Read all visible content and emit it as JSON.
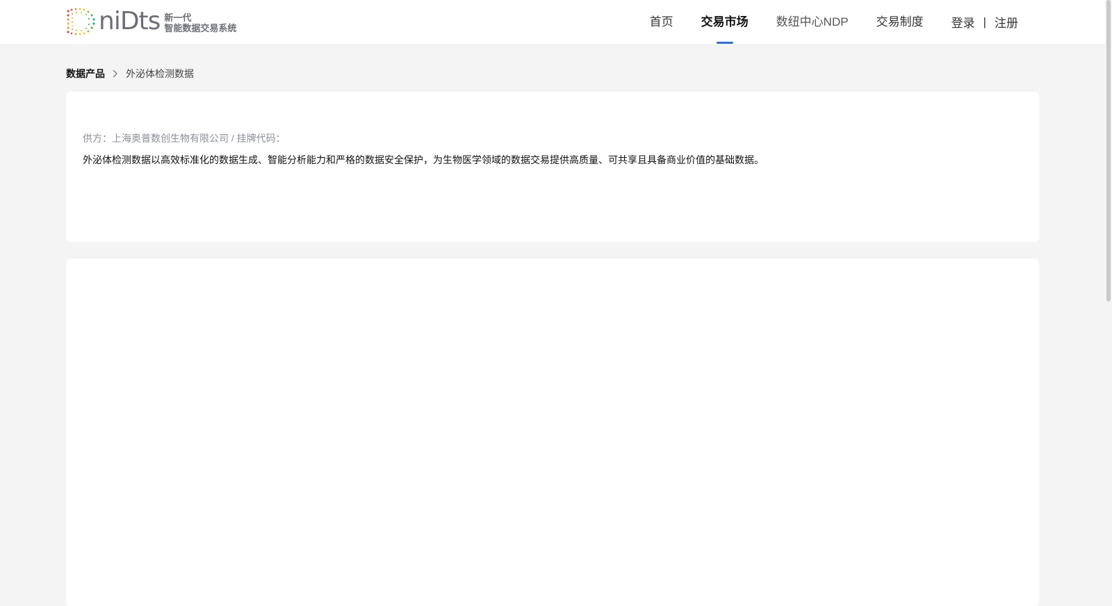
{
  "header": {
    "logo": {
      "word": "niDts",
      "sub_line1": "新一代",
      "sub_line2": "智能数据交易系统"
    },
    "nav": [
      {
        "label": "首页",
        "active": false
      },
      {
        "label": "交易市场",
        "active": true
      },
      {
        "label": "数纽中心NDP",
        "active": false
      },
      {
        "label": "交易制度",
        "active": false
      }
    ],
    "auth": {
      "login": "登录",
      "separator": "|",
      "register": "注册"
    },
    "accent_color": "#2f6fe6"
  },
  "breadcrumb": {
    "root": "数据产品",
    "current": "外泌体检测数据"
  },
  "product": {
    "supplier_line": "供方：上海奥普数创生物有限公司 / 挂牌代码：",
    "description": "外泌体检测数据以高效标准化的数据生成、智能分析能力和严格的数据安全保护，为生物医学领域的数据交易提供高质量、可共享且具备商业价值的基础数据。"
  }
}
